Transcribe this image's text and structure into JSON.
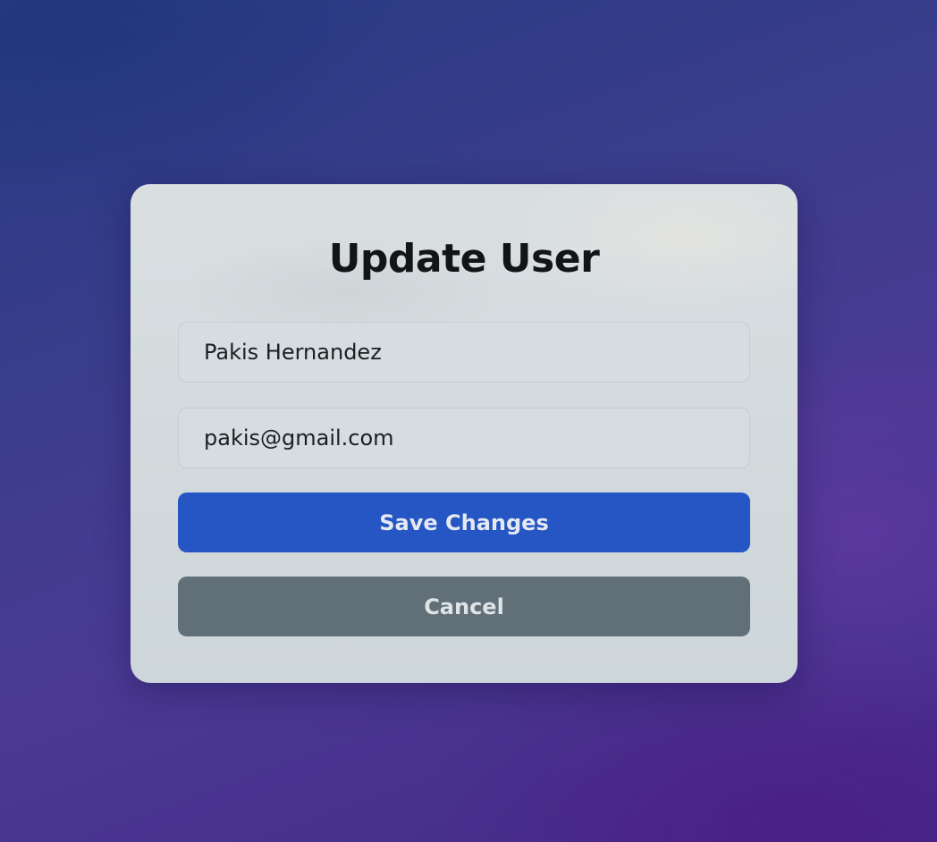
{
  "form": {
    "title": "Update User",
    "name_value": "Pakis Hernandez",
    "email_value": "pakis@gmail.com",
    "save_label": "Save Changes",
    "cancel_label": "Cancel"
  },
  "colors": {
    "primary_button": "#2656c4",
    "secondary_button": "#617078",
    "card_background": "#d6dde0",
    "title_text": "#121518"
  }
}
